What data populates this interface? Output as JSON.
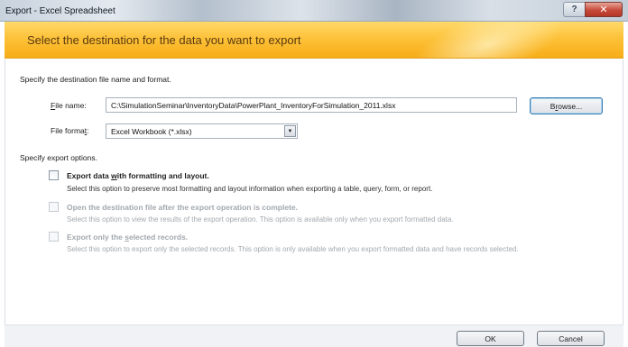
{
  "window": {
    "title": "Export - Excel Spreadsheet",
    "help_glyph": "?",
    "close_glyph": "✕"
  },
  "banner": {
    "heading": "Select the destination for the data you want to export"
  },
  "destination": {
    "section_label": "Specify the destination file name and format.",
    "file_name_label": "File name:",
    "file_name_value": "C:\\SimulationSeminar\\InventoryData\\PowerPlant_InventoryForSimulation_2011.xlsx",
    "browse_label": "Browse...",
    "file_format_label": "File format:",
    "file_format_value": "Excel Workbook (*.xlsx)",
    "dropdown_arrow": "▼"
  },
  "export_options": {
    "section_label": "Specify export options.",
    "options": [
      {
        "title": "Export data with formatting and layout.",
        "description": "Select this option to preserve most formatting and layout information when exporting a table, query, form, or report.",
        "checked": false,
        "enabled": true
      },
      {
        "title": "Open the destination file after the export operation is complete.",
        "description": "Select this option to view the results of the export operation. This option is available only when you export formatted data.",
        "checked": false,
        "enabled": false
      },
      {
        "title": "Export only the selected records.",
        "description": "Select this option to export only the selected records. This option is only available when you export formatted data and have records selected.",
        "checked": false,
        "enabled": false
      }
    ]
  },
  "footer": {
    "ok_label": "OK",
    "cancel_label": "Cancel"
  }
}
